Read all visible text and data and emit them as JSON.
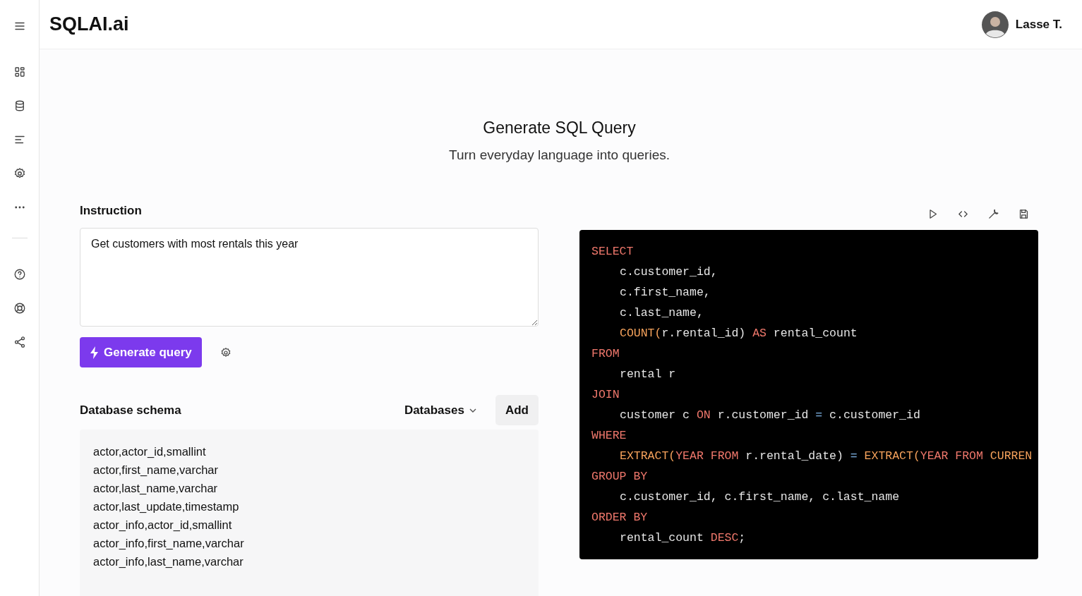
{
  "header": {
    "brand": "SQLAI.ai",
    "user_name": "Lasse T."
  },
  "intro": {
    "title": "Generate SQL Query",
    "subtitle": "Turn everyday language into queries."
  },
  "instruction": {
    "label": "Instruction",
    "value": "Get customers with most rentals this year"
  },
  "generate_button": {
    "label": "Generate query"
  },
  "schema": {
    "label": "Database schema",
    "dropdown": "Databases",
    "add_button": "Add",
    "lines": [
      "actor,actor_id,smallint",
      "actor,first_name,varchar",
      "actor,last_name,varchar",
      "actor,last_update,timestamp",
      "actor_info,actor_id,smallint",
      "actor_info,first_name,varchar",
      "actor_info,last_name,varchar"
    ]
  },
  "code": [
    {
      "indented": false,
      "tokens": [
        {
          "kind": "keyword",
          "text": "SELECT"
        }
      ]
    },
    {
      "indented": true,
      "tokens": [
        {
          "kind": "plain",
          "text": "c.customer_id,"
        }
      ]
    },
    {
      "indented": true,
      "tokens": [
        {
          "kind": "plain",
          "text": "c.first_name,"
        }
      ]
    },
    {
      "indented": true,
      "tokens": [
        {
          "kind": "plain",
          "text": "c.last_name,"
        }
      ]
    },
    {
      "indented": true,
      "tokens": [
        {
          "kind": "function",
          "text": "COUNT("
        },
        {
          "kind": "plain",
          "text": "r.rental_id) "
        },
        {
          "kind": "keyword",
          "text": "AS"
        },
        {
          "kind": "plain",
          "text": " rental_count"
        }
      ]
    },
    {
      "indented": false,
      "tokens": [
        {
          "kind": "keyword",
          "text": "FROM"
        }
      ]
    },
    {
      "indented": true,
      "tokens": [
        {
          "kind": "plain",
          "text": "rental r"
        }
      ]
    },
    {
      "indented": false,
      "tokens": [
        {
          "kind": "keyword",
          "text": "JOIN"
        }
      ]
    },
    {
      "indented": true,
      "tokens": [
        {
          "kind": "plain",
          "text": "customer c "
        },
        {
          "kind": "keyword",
          "text": "ON"
        },
        {
          "kind": "plain",
          "text": " r.customer_id "
        },
        {
          "kind": "operator",
          "text": "="
        },
        {
          "kind": "plain",
          "text": " c.customer_id"
        }
      ]
    },
    {
      "indented": false,
      "tokens": [
        {
          "kind": "keyword",
          "text": "WHERE"
        }
      ]
    },
    {
      "indented": true,
      "tokens": [
        {
          "kind": "function",
          "text": "EXTRACT("
        },
        {
          "kind": "keyword",
          "text": "YEAR FROM"
        },
        {
          "kind": "plain",
          "text": " r.rental_date) "
        },
        {
          "kind": "operator",
          "text": "= "
        },
        {
          "kind": "function",
          "text": "EXTRACT("
        },
        {
          "kind": "keyword",
          "text": "YEAR FROM "
        },
        {
          "kind": "function",
          "text": "CURREN"
        }
      ]
    },
    {
      "indented": false,
      "tokens": [
        {
          "kind": "keyword",
          "text": "GROUP BY"
        }
      ]
    },
    {
      "indented": true,
      "tokens": [
        {
          "kind": "plain",
          "text": "c.customer_id, c.first_name, c.last_name"
        }
      ]
    },
    {
      "indented": false,
      "tokens": [
        {
          "kind": "keyword",
          "text": "ORDER BY"
        }
      ]
    },
    {
      "indented": true,
      "tokens": [
        {
          "kind": "plain",
          "text": "rental_count "
        },
        {
          "kind": "keyword",
          "text": "DESC"
        },
        {
          "kind": "plain",
          "text": ";"
        }
      ]
    }
  ]
}
